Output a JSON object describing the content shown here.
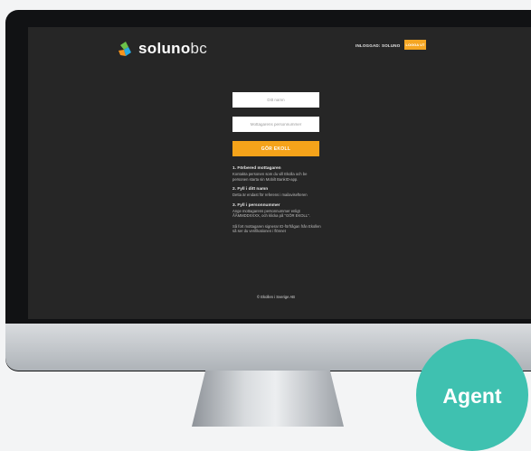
{
  "brand": {
    "name_main": "soluno",
    "name_suffix": "bc",
    "colors": {
      "accent": "#f5a623",
      "logo_green": "#6cc24a",
      "logo_blue": "#29abe2",
      "logo_orange": "#f7941d"
    }
  },
  "nav": {
    "login_link": "INLOGGAD: SOLUNO",
    "cta_button": "LOGGA UT"
  },
  "form": {
    "name_placeholder": "Ditt namn",
    "personal_number_placeholder": "Mottagarens personnummer",
    "submit_label": "GÖR EKOLL"
  },
  "steps": [
    {
      "title": "1. Förbered mottagaren",
      "text": "Kontakta personen som du vill Ekolla och be personen starta sin Mobilt BankID-app."
    },
    {
      "title": "2. Fyll i ditt namn",
      "text": "Detta är endast för referens i mailavisefteren"
    },
    {
      "title": "3. Fyll i personnummer",
      "text": "Ange mottagarens personnummer enligt ÅÅMMDDXXXX, och klicka på \"GÖR EKOLL\"."
    }
  ],
  "note": "Så fort mottagaren signerar ID-förfrågan från Ekollen så ser du verifikationen i flönnet",
  "footer": "© Ekollen i Sverige AB",
  "overlay": {
    "badge": "Agent",
    "badge_color": "#3fc1b0"
  }
}
